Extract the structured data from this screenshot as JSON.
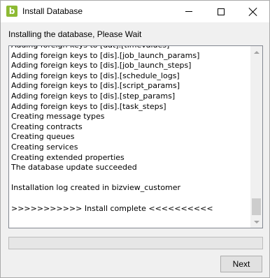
{
  "window": {
    "title": "Install Database",
    "icon_letter": "b",
    "accent_color": "#8dba33"
  },
  "status_label": "Installing the database, Please Wait",
  "log": {
    "lines": [
      "Adding foreign keys to [dat].[timevalues]",
      "Adding foreign keys to [dis].[job_launch_params]",
      "Adding foreign keys to [dis].[job_launch_steps]",
      "Adding foreign keys to [dis].[schedule_logs]",
      "Adding foreign keys to [dis].[script_params]",
      "Adding foreign keys to [dis].[step_params]",
      "Adding foreign keys to [dis].[task_steps]",
      "Creating message types",
      "Creating contracts",
      "Creating queues",
      "Creating services",
      "Creating extended properties",
      "The database update succeeded",
      "",
      "Installation log created in bizview_customer",
      "",
      ">>>>>>>>>>> Install complete <<<<<<<<<<"
    ]
  },
  "progress": {
    "value": 0
  },
  "buttons": {
    "next_label": "Next"
  }
}
